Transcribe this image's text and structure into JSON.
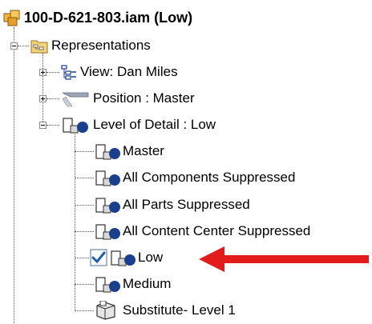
{
  "tree": {
    "root_label": "100-D-621-803.iam (Low)",
    "representations_label": "Representations",
    "view_label": "View: Dan Miles",
    "position_label": "Position : Master",
    "lod_label": "Level of Detail : Low",
    "lod_items": [
      {
        "label": "Master",
        "icon": "lod-icon"
      },
      {
        "label": "All Components Suppressed",
        "icon": "lod-icon"
      },
      {
        "label": "All Parts Suppressed",
        "icon": "lod-icon"
      },
      {
        "label": "All Content Center Suppressed",
        "icon": "lod-icon"
      },
      {
        "label": "Low",
        "icon": "lod-icon",
        "active": true
      },
      {
        "label": "Medium",
        "icon": "lod-icon"
      },
      {
        "label": "Substitute- Level 1",
        "icon": "substitute-icon"
      }
    ]
  },
  "colors": {
    "arrow": "#e41b1b",
    "check": "#1a5fb4",
    "lod_blue": "#1b3f8f"
  }
}
